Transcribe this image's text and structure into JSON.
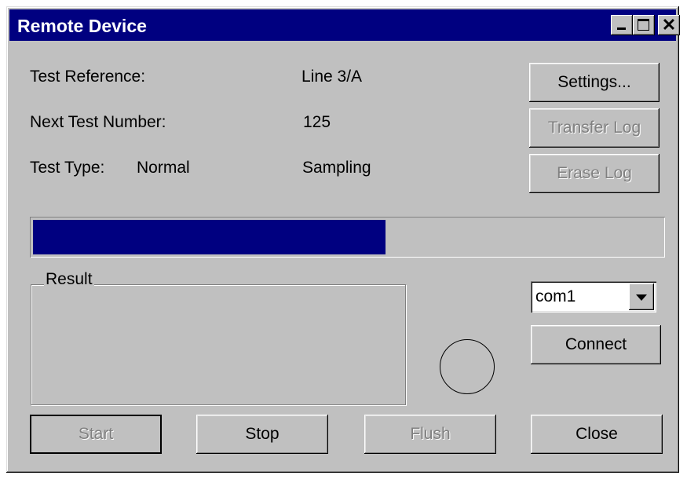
{
  "window": {
    "title": "Remote Device",
    "controls": {
      "minimize_icon": "minimize-icon",
      "maximize_icon": "maximize-icon",
      "close_glyph": "✕"
    }
  },
  "info": {
    "test_reference_label": "Test Reference:",
    "test_reference_value": "Line 3/A",
    "next_test_number_label": "Next Test Number:",
    "next_test_number_value": "125",
    "test_type_label": "Test Type:",
    "test_type_mode": "Normal",
    "test_type_value": "Sampling"
  },
  "side_buttons": {
    "settings": "Settings...",
    "transfer_log": "Transfer Log",
    "erase_log": "Erase Log"
  },
  "progress": {
    "fraction": 0.56,
    "fill_color": "#000080"
  },
  "result": {
    "label": "Result"
  },
  "connection": {
    "port_selected": "com1",
    "connect": "Connect"
  },
  "bottom_buttons": {
    "start": "Start",
    "stop": "Stop",
    "flush": "Flush",
    "close": "Close"
  },
  "colors": {
    "titlebar": "#000080",
    "face": "#c0c0c0",
    "disabled_text": "#808080"
  }
}
